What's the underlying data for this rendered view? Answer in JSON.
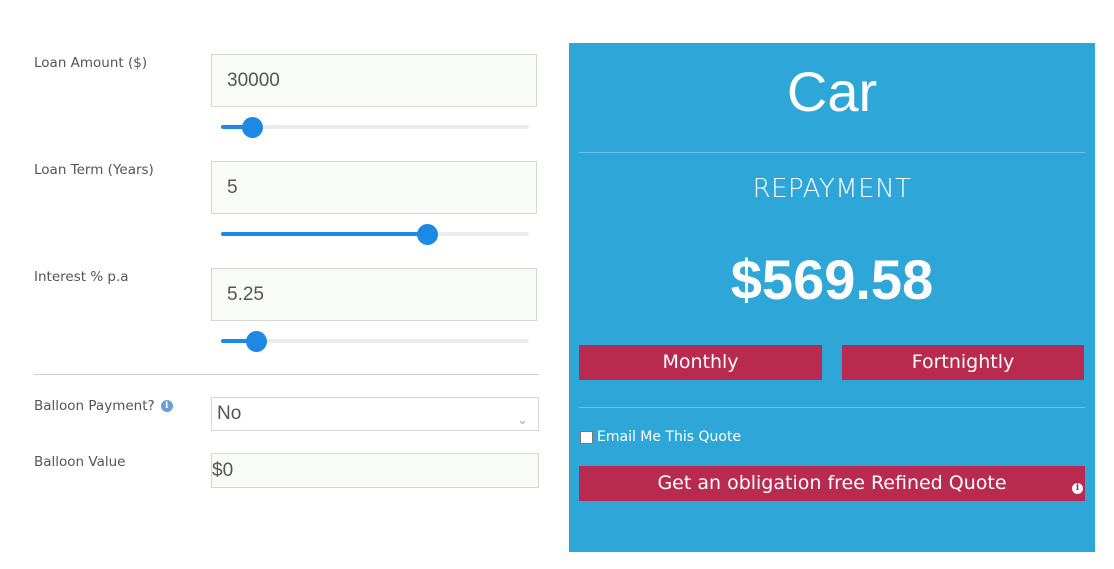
{
  "form": {
    "loan_amount": {
      "label": "Loan Amount ($)",
      "value": "30000",
      "slider_fraction": 0.1
    },
    "loan_term": {
      "label": "Loan Term (Years)",
      "value": "5",
      "slider_fraction": 0.67
    },
    "interest": {
      "label": "Interest % p.a",
      "value": "5.25",
      "slider_fraction": 0.115
    },
    "balloon_payment": {
      "label": "Balloon Payment?",
      "selected": "No"
    },
    "balloon_value": {
      "label": "Balloon Value",
      "value": "$0"
    }
  },
  "result": {
    "title": "Car",
    "repayment_label": "REPAYMENT",
    "amount": "$569.58",
    "monthly_label": "Monthly",
    "fortnightly_label": "Fortnightly",
    "email_label": "Email Me This Quote",
    "quote_button_label": "Get an obligation free Refined Quote"
  },
  "colors": {
    "panel": "#2ea6d8",
    "button": "#b82a50",
    "slider_accent": "#1e88e5"
  },
  "icons": {
    "balloon_info": "info-icon",
    "quote_info": "info-icon",
    "select_chevron": "chevron-down-icon"
  }
}
